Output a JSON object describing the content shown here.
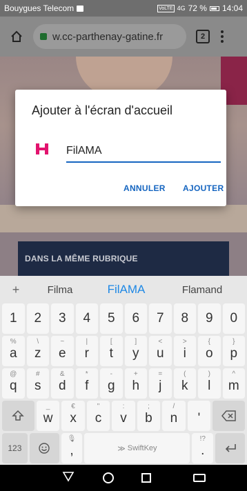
{
  "status": {
    "carrier": "Bouygues Telecom",
    "volte": "VoLTE",
    "signal": "4G",
    "battery": "72 %",
    "time": "14:04"
  },
  "browser": {
    "url": "w.cc-parthenay-gatine.fr",
    "tab_count": "2"
  },
  "page": {
    "rubrique": "DANS LA MÊME RUBRIQUE"
  },
  "dialog": {
    "title": "Ajouter à l'écran d'accueil",
    "app_name": "FilAMA",
    "cancel_label": "ANNULER",
    "add_label": "AJOUTER"
  },
  "keyboard": {
    "suggestions": [
      "Filma",
      "FilAMA",
      "Flamand"
    ],
    "numbers": [
      "1",
      "2",
      "3",
      "4",
      "5",
      "6",
      "7",
      "8",
      "9",
      "0"
    ],
    "row1": [
      {
        "k": "a",
        "alt": "%"
      },
      {
        "k": "z",
        "alt": "\\"
      },
      {
        "k": "e",
        "alt": "~"
      },
      {
        "k": "r",
        "alt": "|"
      },
      {
        "k": "t",
        "alt": "["
      },
      {
        "k": "y",
        "alt": "]"
      },
      {
        "k": "u",
        "alt": "<"
      },
      {
        "k": "i",
        "alt": ">"
      },
      {
        "k": "o",
        "alt": "{"
      },
      {
        "k": "p",
        "alt": "}"
      }
    ],
    "row2": [
      {
        "k": "q",
        "alt": "@"
      },
      {
        "k": "s",
        "alt": "#"
      },
      {
        "k": "d",
        "alt": "&"
      },
      {
        "k": "f",
        "alt": "*"
      },
      {
        "k": "g",
        "alt": "-"
      },
      {
        "k": "h",
        "alt": "+"
      },
      {
        "k": "j",
        "alt": "="
      },
      {
        "k": "k",
        "alt": "("
      },
      {
        "k": "l",
        "alt": ")"
      },
      {
        "k": "m",
        "alt": "^"
      }
    ],
    "row3": [
      {
        "k": "w",
        "alt": "_"
      },
      {
        "k": "x",
        "alt": "€"
      },
      {
        "k": "c",
        "alt": "\""
      },
      {
        "k": "v",
        "alt": ":"
      },
      {
        "k": "b",
        "alt": ";"
      },
      {
        "k": "n",
        "alt": "/"
      },
      {
        "k": "'",
        "alt": ""
      }
    ],
    "numbers_key": "123",
    "comma": ",",
    "space_label": "SwiftKey",
    "period": ".",
    "period_alt": "!?"
  }
}
